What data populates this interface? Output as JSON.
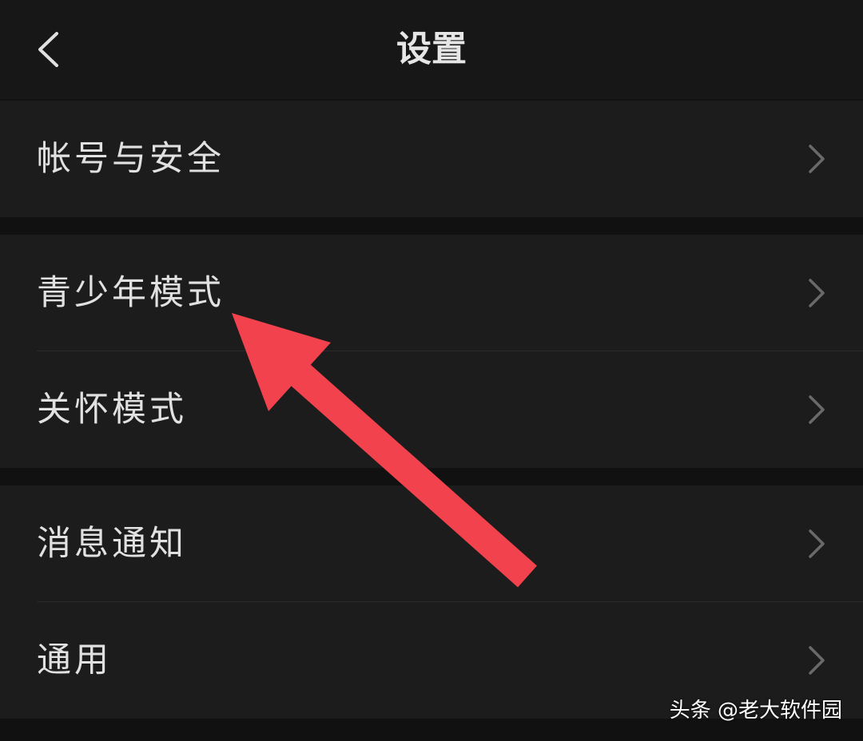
{
  "header": {
    "title": "设置",
    "back_icon": "chevron-left-icon"
  },
  "groups": [
    {
      "items": [
        {
          "label": "帐号与安全"
        }
      ]
    },
    {
      "items": [
        {
          "label": "青少年模式"
        },
        {
          "label": "关怀模式"
        }
      ]
    },
    {
      "items": [
        {
          "label": "消息通知"
        },
        {
          "label": "通用"
        }
      ]
    }
  ],
  "annotation": {
    "arrow_color": "#f2424d",
    "points_to": "青少年模式"
  },
  "watermark": "头条 @老大软件园",
  "colors": {
    "background": "#111111",
    "header_bg": "#171717",
    "row_bg": "#1c1c1c",
    "text": "#e1e1e1",
    "chevron": "#6a6a6a",
    "divider": "#2a2a2a"
  }
}
